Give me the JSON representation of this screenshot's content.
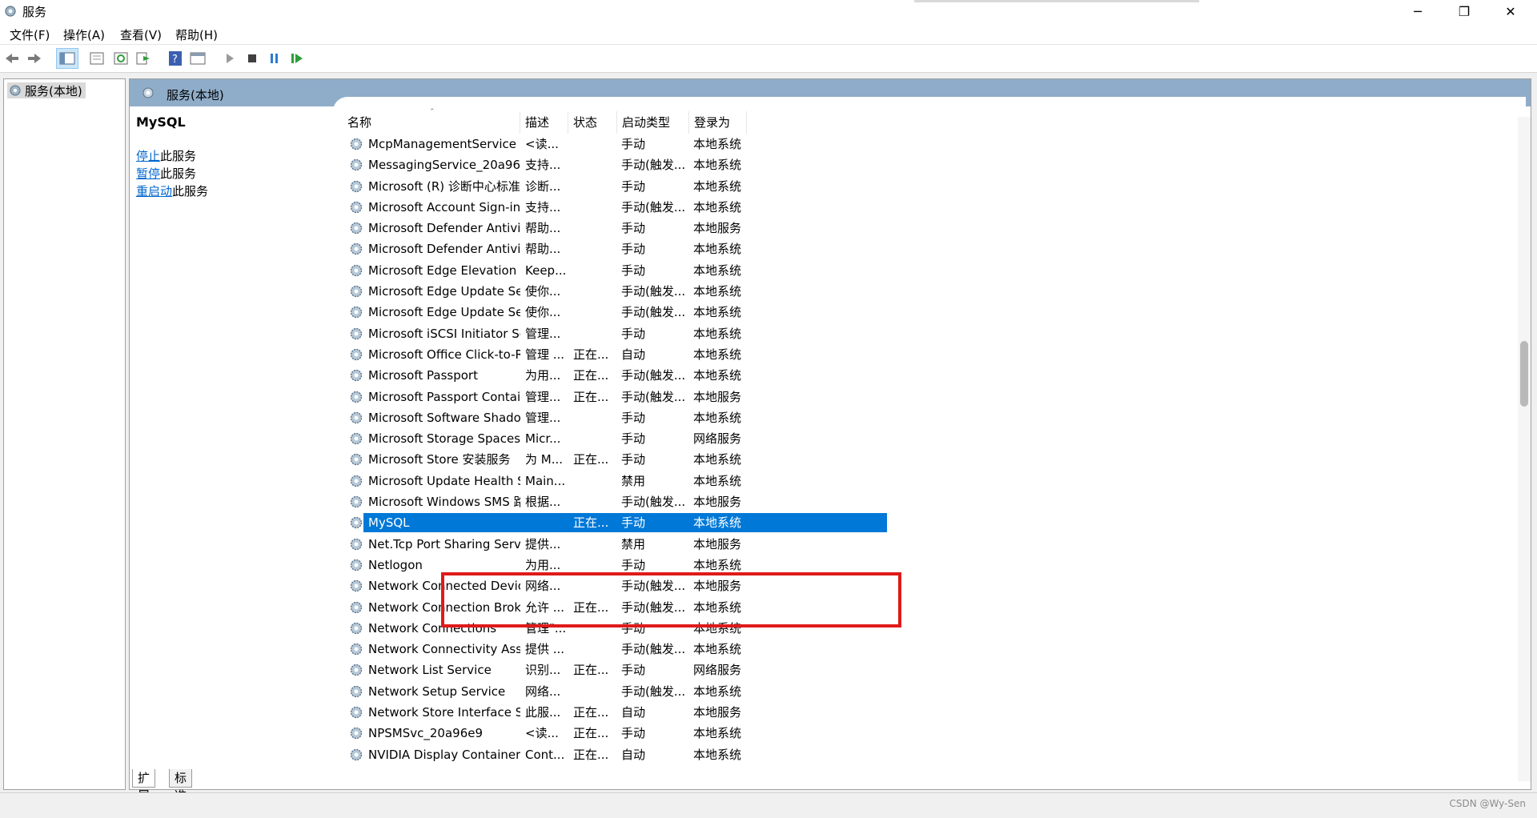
{
  "window": {
    "title": "服务",
    "icon": "services-gear-icon",
    "controls": {
      "minimize": "─",
      "maximize": "❐",
      "close": "✕"
    }
  },
  "menu": [
    "文件(F)",
    "操作(A)",
    "查看(V)",
    "帮助(H)"
  ],
  "toolbar": [
    "back-arrow-icon",
    "forward-arrow-icon",
    "console-tree-icon",
    "properties-icon",
    "refresh-icon",
    "export-icon",
    "help-icon",
    "view-icon",
    "start-service-icon",
    "stop-service-icon",
    "pause-service-icon",
    "resume-service-icon"
  ],
  "tree": {
    "root_label": "服务(本地)"
  },
  "panel": {
    "header": "服务(本地)",
    "selected_service": "MySQL",
    "actions": [
      {
        "link": "停止",
        "suffix": "此服务"
      },
      {
        "link": "暂停",
        "suffix": "此服务"
      },
      {
        "link": "重启动",
        "suffix": "此服务"
      }
    ]
  },
  "columns": {
    "name": "名称",
    "desc": "描述",
    "status": "状态",
    "startup": "启动类型",
    "logon": "登录为"
  },
  "services": [
    {
      "name": "McpManagementService",
      "desc": "<读...",
      "status": "",
      "startup": "手动",
      "logon": "本地系统"
    },
    {
      "name": "MessagingService_20a96e9",
      "desc": "支持...",
      "status": "",
      "startup": "手动(触发...",
      "logon": "本地系统"
    },
    {
      "name": "Microsoft (R) 诊断中心标准...",
      "desc": "诊断...",
      "status": "",
      "startup": "手动",
      "logon": "本地系统"
    },
    {
      "name": "Microsoft Account Sign-in ...",
      "desc": "支持...",
      "status": "",
      "startup": "手动(触发...",
      "logon": "本地系统"
    },
    {
      "name": "Microsoft Defender Antivir...",
      "desc": "帮助...",
      "status": "",
      "startup": "手动",
      "logon": "本地服务"
    },
    {
      "name": "Microsoft Defender Antivir...",
      "desc": "帮助...",
      "status": "",
      "startup": "手动",
      "logon": "本地系统"
    },
    {
      "name": "Microsoft Edge Elevation S...",
      "desc": "Keep...",
      "status": "",
      "startup": "手动",
      "logon": "本地系统"
    },
    {
      "name": "Microsoft Edge Update Ser...",
      "desc": "使你...",
      "status": "",
      "startup": "手动(触发...",
      "logon": "本地系统"
    },
    {
      "name": "Microsoft Edge Update Ser...",
      "desc": "使你...",
      "status": "",
      "startup": "手动(触发...",
      "logon": "本地系统"
    },
    {
      "name": "Microsoft iSCSI Initiator Ser...",
      "desc": "管理...",
      "status": "",
      "startup": "手动",
      "logon": "本地系统"
    },
    {
      "name": "Microsoft Office Click-to-R...",
      "desc": "管理 ...",
      "status": "正在...",
      "startup": "自动",
      "logon": "本地系统"
    },
    {
      "name": "Microsoft Passport",
      "desc": "为用...",
      "status": "正在...",
      "startup": "手动(触发...",
      "logon": "本地系统"
    },
    {
      "name": "Microsoft Passport Container",
      "desc": "管理...",
      "status": "正在...",
      "startup": "手动(触发...",
      "logon": "本地服务"
    },
    {
      "name": "Microsoft Software Shado...",
      "desc": "管理...",
      "status": "",
      "startup": "手动",
      "logon": "本地系统"
    },
    {
      "name": "Microsoft Storage Spaces S...",
      "desc": "Micr...",
      "status": "",
      "startup": "手动",
      "logon": "网络服务"
    },
    {
      "name": "Microsoft Store 安装服务",
      "desc": "为 M...",
      "status": "正在...",
      "startup": "手动",
      "logon": "本地系统"
    },
    {
      "name": "Microsoft Update Health S...",
      "desc": "Main...",
      "status": "",
      "startup": "禁用",
      "logon": "本地系统"
    },
    {
      "name": "Microsoft Windows SMS 路...",
      "desc": "根据...",
      "status": "",
      "startup": "手动(触发...",
      "logon": "本地服务"
    },
    {
      "name": "MySQL",
      "desc": "",
      "status": "正在...",
      "startup": "手动",
      "logon": "本地系统",
      "selected": true
    },
    {
      "name": "Net.Tcp Port Sharing Service",
      "desc": "提供...",
      "status": "",
      "startup": "禁用",
      "logon": "本地服务"
    },
    {
      "name": "Netlogon",
      "desc": "为用...",
      "status": "",
      "startup": "手动",
      "logon": "本地系统"
    },
    {
      "name": "Network Connected Devic...",
      "desc": "网络...",
      "status": "",
      "startup": "手动(触发...",
      "logon": "本地服务"
    },
    {
      "name": "Network Connection Broker",
      "desc": "允许 ...",
      "status": "正在...",
      "startup": "手动(触发...",
      "logon": "本地系统"
    },
    {
      "name": "Network Connections",
      "desc": "管理\"...",
      "status": "",
      "startup": "手动",
      "logon": "本地系统"
    },
    {
      "name": "Network Connectivity Assis...",
      "desc": "提供 ...",
      "status": "",
      "startup": "手动(触发...",
      "logon": "本地系统"
    },
    {
      "name": "Network List Service",
      "desc": "识别...",
      "status": "正在...",
      "startup": "手动",
      "logon": "网络服务"
    },
    {
      "name": "Network Setup Service",
      "desc": "网络...",
      "status": "",
      "startup": "手动(触发...",
      "logon": "本地系统"
    },
    {
      "name": "Network Store Interface Se...",
      "desc": "此服...",
      "status": "正在...",
      "startup": "自动",
      "logon": "本地服务"
    },
    {
      "name": "NPSMSvc_20a96e9",
      "desc": "<读...",
      "status": "正在...",
      "startup": "手动",
      "logon": "本地系统"
    },
    {
      "name": "NVIDIA Display Container LS",
      "desc": "Cont...",
      "status": "正在...",
      "startup": "自动",
      "logon": "本地系统"
    }
  ],
  "tabs": [
    "扩展",
    "标准"
  ],
  "watermark": "CSDN @Wy-Sen",
  "colors": {
    "selection": "#0078d7",
    "header": "#8fadc9",
    "highlight": "#e01a1a",
    "link": "#0066cc"
  }
}
